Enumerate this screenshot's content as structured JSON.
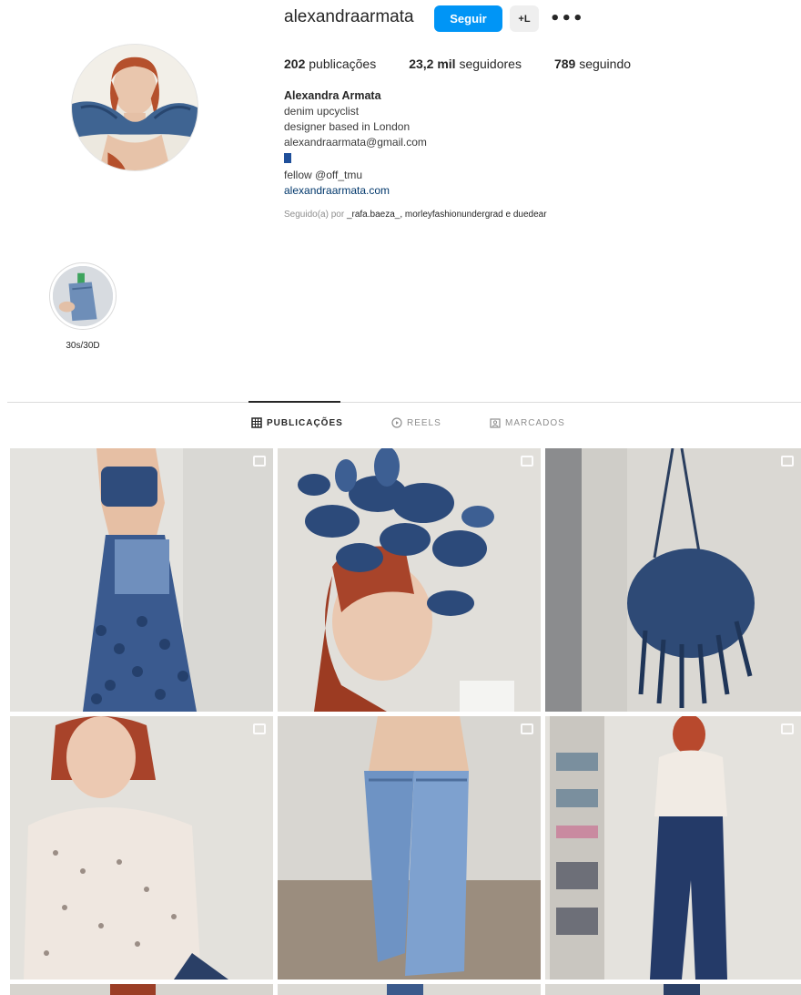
{
  "profile": {
    "username": "alexandraarmata",
    "follow_label": "Seguir",
    "suggest_label": "+L",
    "more_label": "•••",
    "stats": {
      "posts_count": "202",
      "posts_label": "publicações",
      "followers_count": "23,2 mil",
      "followers_label": "seguidores",
      "following_count": "789",
      "following_label": "seguindo"
    },
    "bio": {
      "name": "Alexandra Armata",
      "line1": "denim upcyclist",
      "line2": "designer based in London",
      "email": "alexandraarmata@gmail.com",
      "line4": "fellow @off_tmu",
      "website": "alexandraarmata.com"
    },
    "followed_by": {
      "prefix": "Seguido(a) por",
      "names": "_rafa.baeza_, morleyfashionundergrad e duedear"
    }
  },
  "highlights": [
    {
      "label": "30s/30D",
      "icon": "denim-highlight-thumbnail"
    }
  ],
  "tabs": [
    {
      "label": "PUBLICAÇÕES",
      "icon": "grid-icon",
      "active": true
    },
    {
      "label": "REELS",
      "icon": "reels-icon",
      "active": false
    },
    {
      "label": "MARCADOS",
      "icon": "tagged-icon",
      "active": false
    }
  ],
  "colors": {
    "accent": "#0095f6",
    "text": "#262626",
    "muted": "#8e8e8e",
    "link": "#00376b"
  }
}
